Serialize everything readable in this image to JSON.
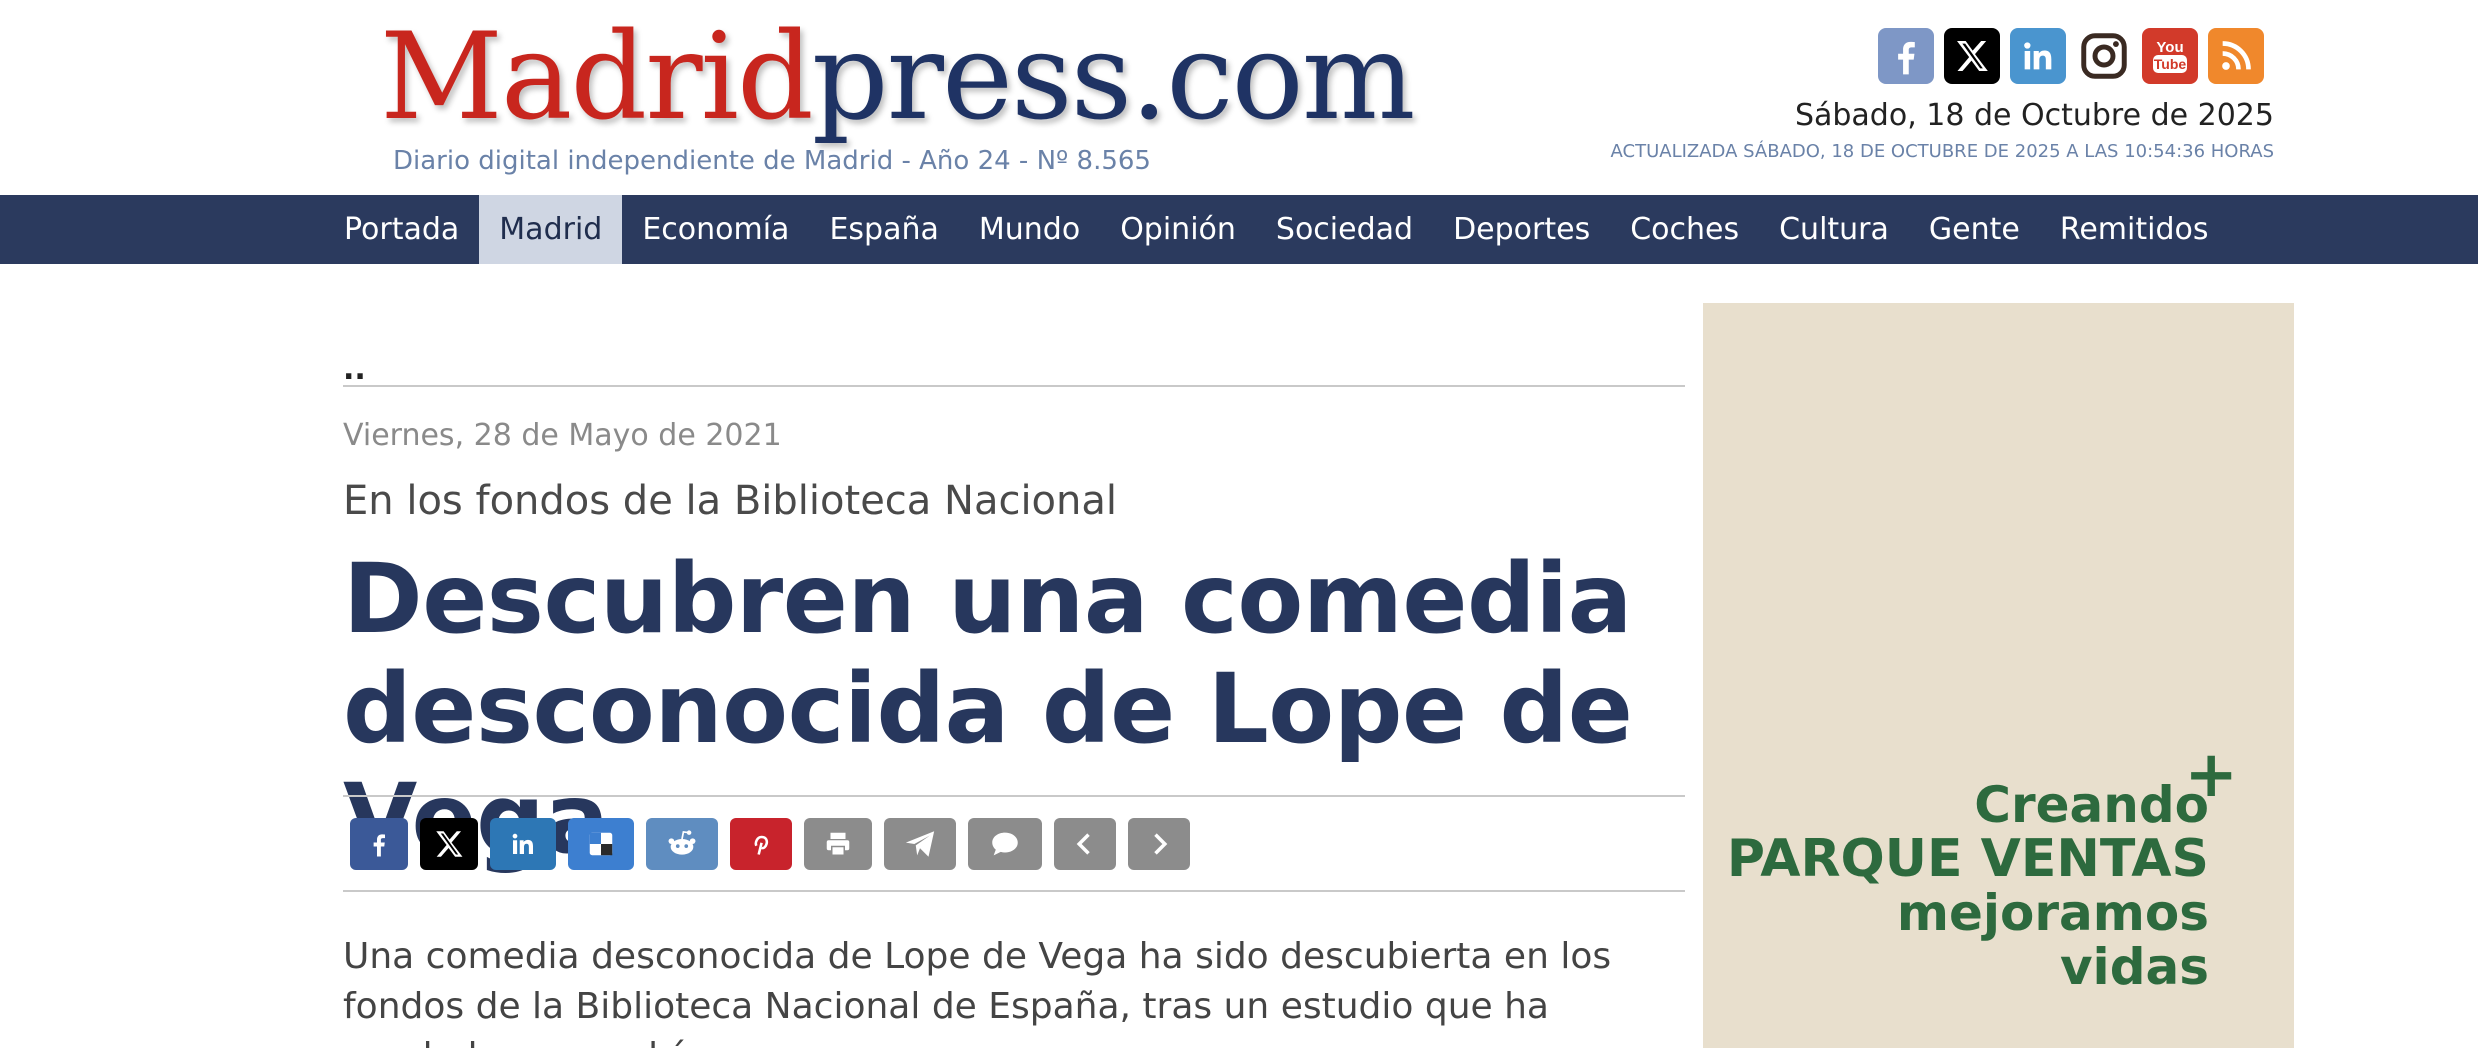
{
  "header": {
    "logo_part1": "Madrid",
    "logo_part2": "press.com",
    "tagline": "Diario digital independiente de Madrid - Año 24 - Nº 8.565",
    "date": "Sábado, 18 de Octubre de 2025",
    "updated": "ACTUALIZADA SÁBADO, 18 DE OCTUBRE DE 2025 A LAS 10:54:36 HORAS",
    "social_icons": [
      "facebook-icon",
      "x-icon",
      "linkedin-icon",
      "instagram-icon",
      "youtube-icon",
      "rss-icon"
    ]
  },
  "nav": {
    "items": [
      "Portada",
      "Madrid",
      "Economía",
      "España",
      "Mundo",
      "Opinión",
      "Sociedad",
      "Deportes",
      "Coches",
      "Cultura",
      "Gente",
      "Remitidos"
    ],
    "active": "Madrid"
  },
  "article": {
    "dots": "..",
    "date": "Viernes, 28 de Mayo de 2021",
    "kicker": "En los fondos de la Biblioteca Nacional",
    "headline": "Descubren una comedia desconocida de Lope de Vega",
    "share_icons": [
      "facebook-icon",
      "x-icon",
      "linkedin-icon",
      "delicious-icon",
      "reddit-icon",
      "pinterest-icon",
      "print-icon",
      "send-icon",
      "comment-icon",
      "previous-icon",
      "next-icon"
    ],
    "body": "Una comedia desconocida de Lope de Vega ha sido descubierta en los fondos de la Biblioteca Nacional de España, tras un estudio que ha revelado que podría"
  },
  "ad": {
    "line1": "Creando",
    "line2": "PARQUE VENTAS",
    "line3": "mejoramos",
    "line4": "vidas",
    "plus": "+",
    "background": "#e8dfcd",
    "text_color": "#2d6a3e"
  },
  "colors": {
    "nav_bg": "#2b3a5e",
    "nav_active_bg": "#cfd6e3",
    "headline": "#27375d",
    "logo_red": "#c8261e",
    "logo_blue": "#1f3364"
  }
}
